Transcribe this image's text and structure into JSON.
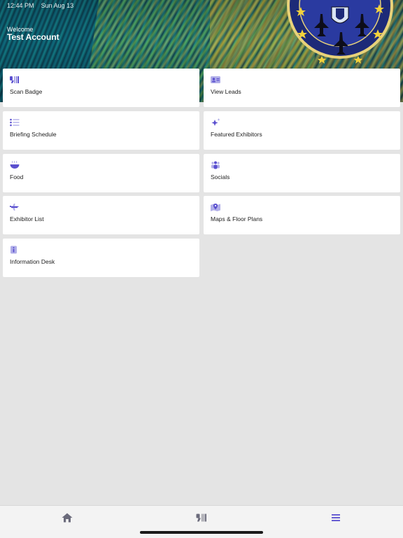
{
  "status": {
    "time": "12:44 PM",
    "date": "Sun Aug 13"
  },
  "header": {
    "welcome": "Welcome",
    "account": "Test Account"
  },
  "colors": {
    "accent": "#5a4fcf",
    "icon_muted": "#6b6b7b"
  },
  "menu": [
    {
      "label": "Scan Badge",
      "icon": "scan-badge-icon"
    },
    {
      "label": "View Leads",
      "icon": "contact-card-icon"
    },
    {
      "label": "Briefing Schedule",
      "icon": "list-icon"
    },
    {
      "label": "Featured Exhibitors",
      "icon": "sparkle-icon"
    },
    {
      "label": "Food",
      "icon": "bowl-icon"
    },
    {
      "label": "Socials",
      "icon": "people-icon"
    },
    {
      "label": "Exhibitor List",
      "icon": "jet-icon"
    },
    {
      "label": "Maps & Floor Plans",
      "icon": "map-pin-icon"
    },
    {
      "label": "Information Desk",
      "icon": "info-icon"
    }
  ],
  "tabs": [
    {
      "name": "home",
      "icon": "home-icon",
      "active": false
    },
    {
      "name": "scan",
      "icon": "scan-badge-icon",
      "active": false
    },
    {
      "name": "menu",
      "icon": "menu-icon",
      "active": true
    }
  ]
}
